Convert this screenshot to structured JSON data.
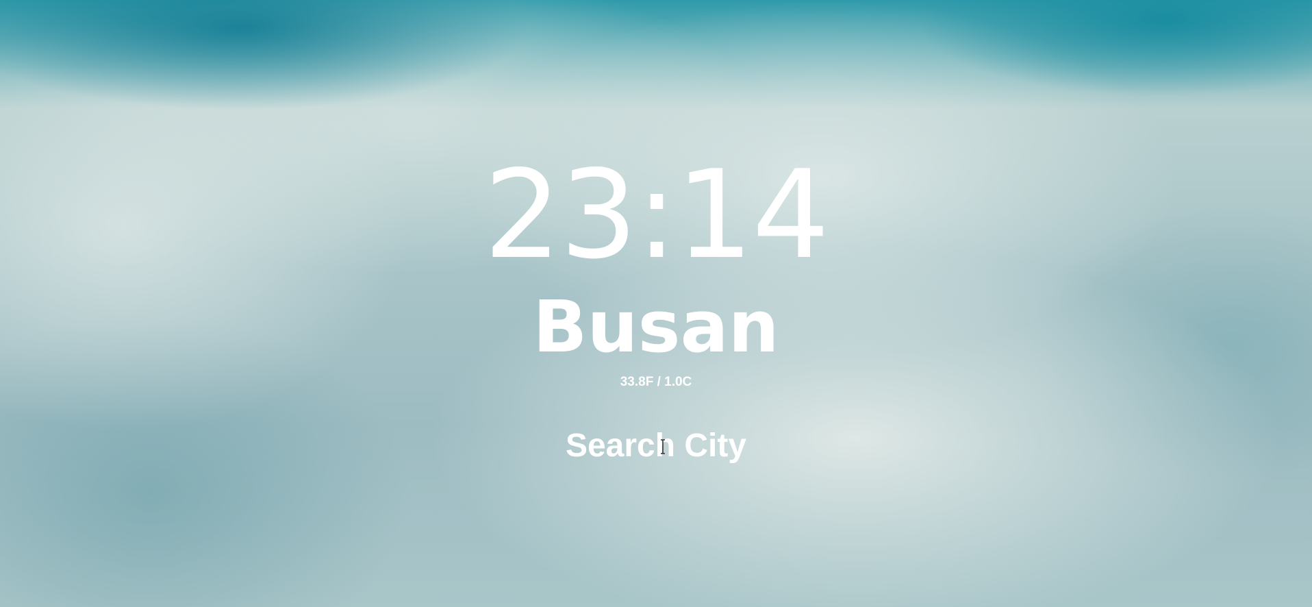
{
  "clock": {
    "time": "23:14"
  },
  "weather": {
    "city": "Busan",
    "temperature": "33.8F / 1.0C"
  },
  "search": {
    "placeholder": "Search City",
    "value": ""
  },
  "colors": {
    "text": "#ffffff",
    "sky_accent": "#1f8ea0"
  },
  "icons": {
    "cursor": "text-cursor-icon"
  }
}
